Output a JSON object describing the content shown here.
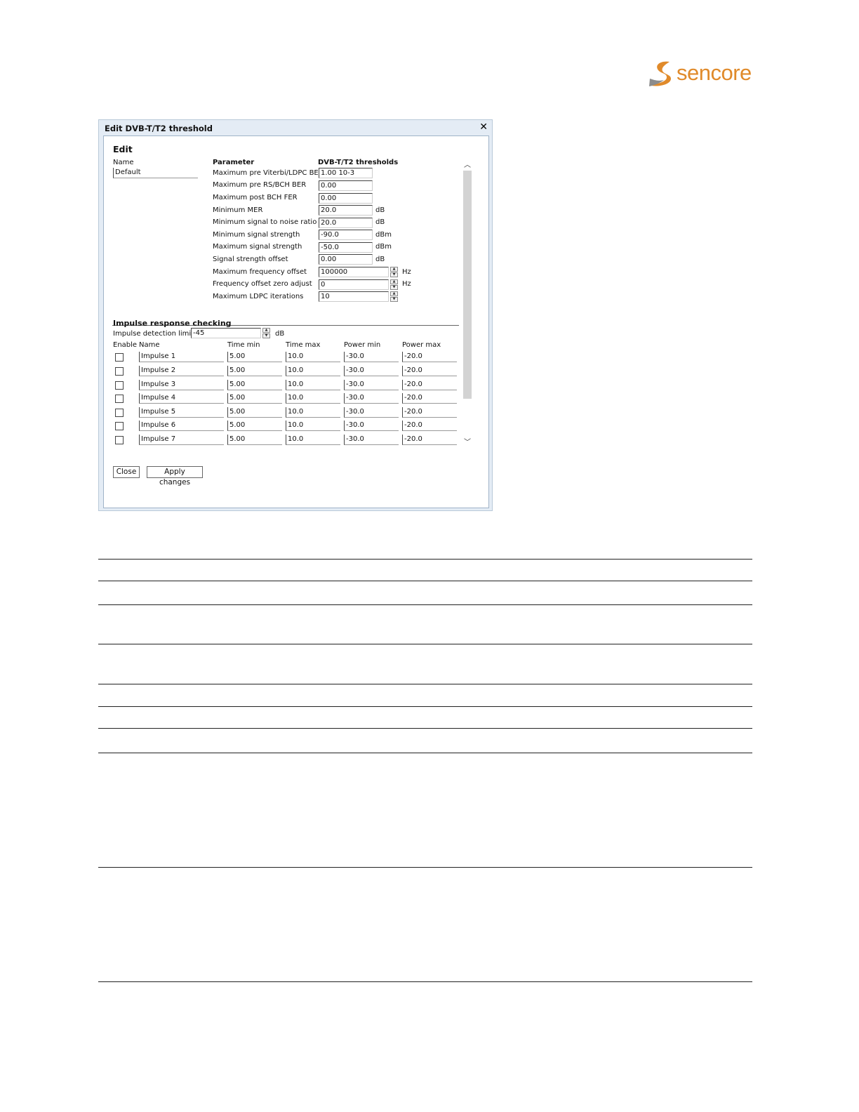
{
  "logo": {
    "text": "sencore",
    "brand_color": "#e08a2a",
    "mark_color": "#8c8c8c"
  },
  "dialog": {
    "title": "Edit DVB-T/T2 threshold",
    "close_icon": "close-icon",
    "edit_heading": "Edit",
    "name_label": "Name",
    "name_value": "Default",
    "param_header": "Parameter",
    "threshold_header": "DVB-T/T2 thresholds",
    "params": [
      {
        "label": "Maximum pre Viterbi/LDPC BER",
        "value": "1.00 10-3",
        "unit": ""
      },
      {
        "label": "Maximum pre RS/BCH BER",
        "value": "0.00",
        "unit": ""
      },
      {
        "label": "Maximum post BCH FER",
        "value": "0.00",
        "unit": ""
      },
      {
        "label": "Minimum MER",
        "value": "20.0",
        "unit": "dB"
      },
      {
        "label": "Minimum signal to noise ratio",
        "value": "20.0",
        "unit": "dB"
      },
      {
        "label": "Minimum signal strength",
        "value": "-90.0",
        "unit": "dBm"
      },
      {
        "label": "Maximum signal strength",
        "value": "-50.0",
        "unit": "dBm"
      },
      {
        "label": "Signal strength offset",
        "value": "0.00",
        "unit": "dB"
      },
      {
        "label": "Maximum frequency offset",
        "value": "100000",
        "unit": "Hz"
      },
      {
        "label": "Frequency offset zero adjust",
        "value": "0",
        "unit": "Hz"
      },
      {
        "label": "Maximum LDPC iterations",
        "value": "10",
        "unit": ""
      }
    ],
    "impulse": {
      "heading": "Impulse response checking",
      "limit_label": "Impulse detection limit",
      "limit_value": "-45",
      "limit_unit": "dB",
      "columns": [
        "Enable",
        "Name",
        "Time min",
        "Time max",
        "Power min",
        "Power max"
      ],
      "rows": [
        {
          "name": "Impulse 1",
          "time_min": "5.00",
          "time_max": "10.0",
          "power_min": "-30.0",
          "power_max": "-20.0"
        },
        {
          "name": "Impulse 2",
          "time_min": "5.00",
          "time_max": "10.0",
          "power_min": "-30.0",
          "power_max": "-20.0"
        },
        {
          "name": "Impulse 3",
          "time_min": "5.00",
          "time_max": "10.0",
          "power_min": "-30.0",
          "power_max": "-20.0"
        },
        {
          "name": "Impulse 4",
          "time_min": "5.00",
          "time_max": "10.0",
          "power_min": "-30.0",
          "power_max": "-20.0"
        },
        {
          "name": "Impulse 5",
          "time_min": "5.00",
          "time_max": "10.0",
          "power_min": "-30.0",
          "power_max": "-20.0"
        },
        {
          "name": "Impulse 6",
          "time_min": "5.00",
          "time_max": "10.0",
          "power_min": "-30.0",
          "power_max": "-20.0"
        },
        {
          "name": "Impulse 7",
          "time_min": "5.00",
          "time_max": "10.0",
          "power_min": "-30.0",
          "power_max": "-20.0"
        }
      ]
    },
    "buttons": {
      "close": "Close",
      "apply": "Apply changes"
    }
  }
}
